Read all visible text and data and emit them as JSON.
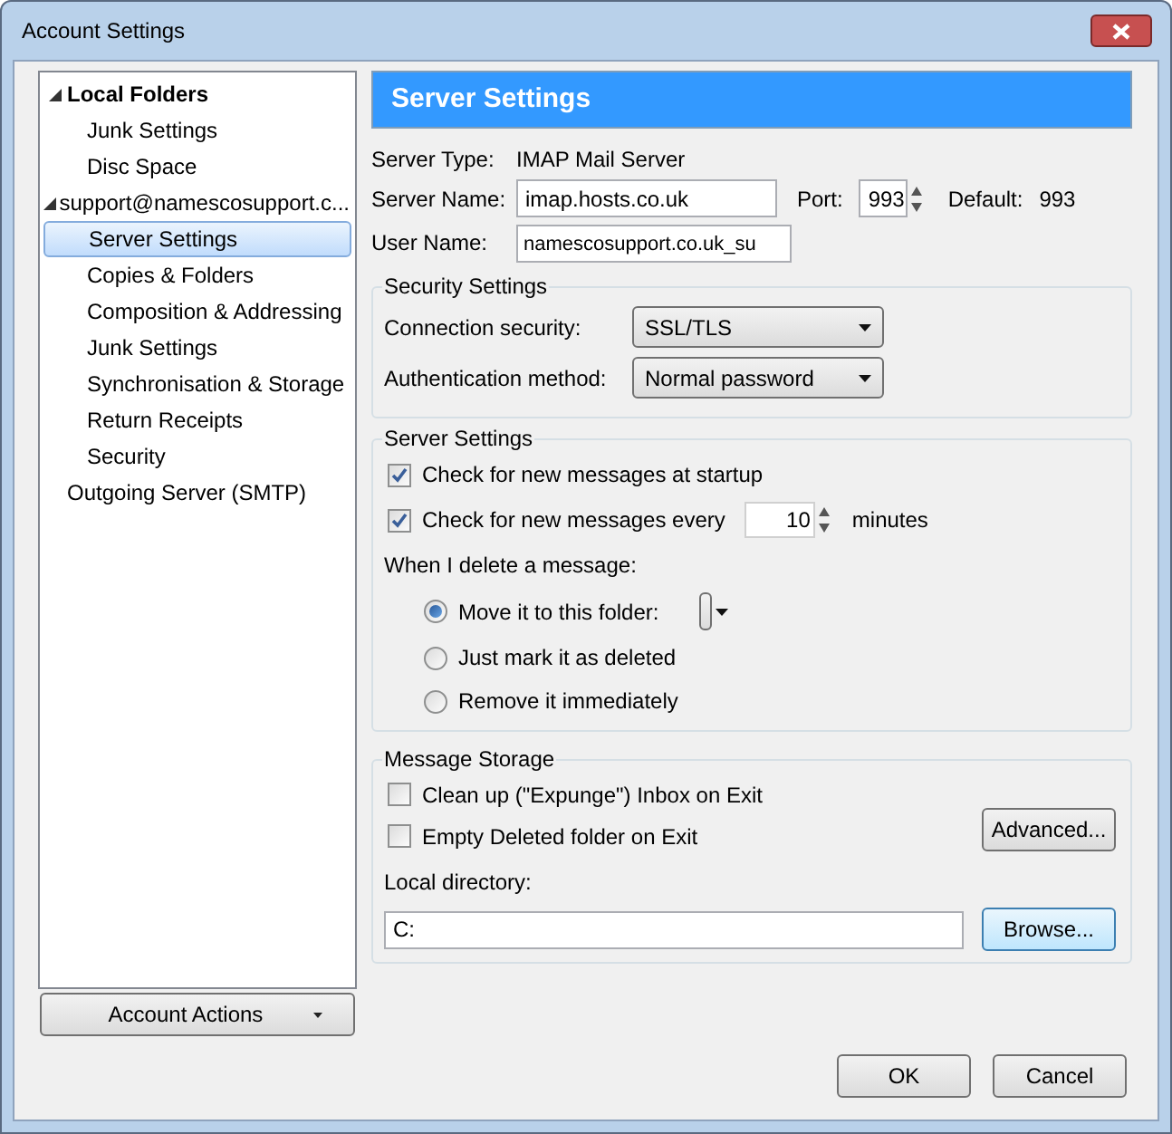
{
  "window": {
    "title": "Account Settings"
  },
  "tree": [
    {
      "label": "Local Folders",
      "expanded": true,
      "default": true,
      "selected": false,
      "children": [
        {
          "label": "Junk Settings",
          "selected": false
        },
        {
          "label": "Disc Space",
          "selected": false
        }
      ]
    },
    {
      "label": "support@namescosupport.c...",
      "expanded": true,
      "default": false,
      "selected": false,
      "children": [
        {
          "label": "Server Settings",
          "selected": true
        },
        {
          "label": "Copies & Folders",
          "selected": false
        },
        {
          "label": "Composition & Addressing",
          "selected": false
        },
        {
          "label": "Junk Settings",
          "selected": false
        },
        {
          "label": "Synchronisation & Storage",
          "selected": false
        },
        {
          "label": "Return Receipts",
          "selected": false
        },
        {
          "label": "Security",
          "selected": false
        }
      ]
    },
    {
      "label": "Outgoing Server (SMTP)",
      "default": false,
      "selected": false
    }
  ],
  "account_actions": "Account Actions",
  "header": "Server Settings",
  "server_type": {
    "label": "Server Type:",
    "value": "IMAP Mail Server"
  },
  "server_name": {
    "label": "Server Name:",
    "value": "imap.hosts.co.uk"
  },
  "port": {
    "label": "Port:",
    "value": "993",
    "default_label": "Default:",
    "default_value": "993"
  },
  "user_name": {
    "label": "User Name:",
    "value": "namescosupport.co.uk_su"
  },
  "security": {
    "legend": "Security Settings",
    "connection": {
      "label": "Connection security:",
      "value": "SSL/TLS"
    },
    "auth": {
      "label": "Authentication method:",
      "value": "Normal password"
    }
  },
  "server_settings": {
    "legend": "Server Settings",
    "check_startup": {
      "label": "Check for new messages at startup",
      "checked": true
    },
    "check_every": {
      "label": "Check for new messages every",
      "checked": true,
      "value": "10",
      "unit": "minutes"
    },
    "delete_label": "When I delete a message:",
    "delete_options": [
      {
        "label": "Move it to this folder:",
        "selected": true,
        "kind": "folder"
      },
      {
        "label": "Just mark it as deleted",
        "selected": false,
        "kind": "plain"
      },
      {
        "label": "Remove it immediately",
        "selected": false,
        "kind": "plain"
      }
    ]
  },
  "storage": {
    "legend": "Message Storage",
    "options": [
      {
        "label": "Clean up (\"Expunge\") Inbox on Exit",
        "checked": false
      },
      {
        "label": "Empty Deleted folder on Exit",
        "checked": false
      }
    ],
    "advanced": "Advanced...",
    "dir_label": "Local directory:",
    "dir_value": "C:",
    "browse": "Browse..."
  },
  "buttons": [
    "OK",
    "Cancel"
  ]
}
